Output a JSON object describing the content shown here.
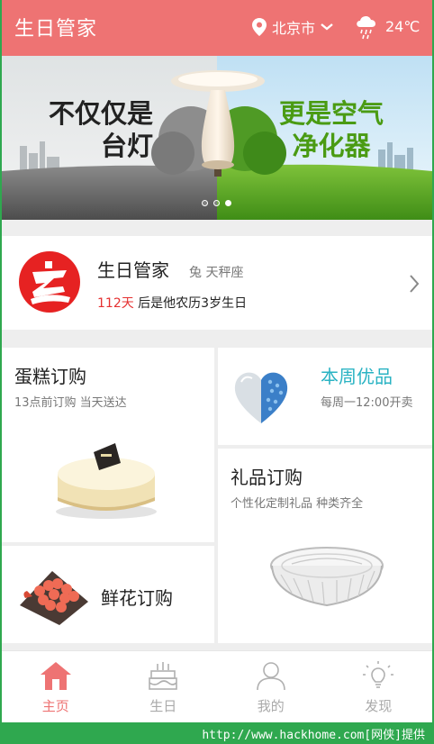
{
  "header": {
    "title": "生日管家",
    "city": "北京市",
    "temperature": "24℃",
    "icons": [
      "location-pin-icon",
      "chevron-down-icon",
      "rain-cloud-icon"
    ]
  },
  "banner": {
    "left_text_line1": "不仅仅是",
    "left_text_line2": "台灯",
    "right_text_line1": "更是空气",
    "right_text_line2": "净化器",
    "page_count": 3,
    "active_page": 3
  },
  "profile": {
    "name": "生日管家",
    "zodiac": "兔 天秤座",
    "days_number": "112天",
    "days_suffix": " 后是他农历3岁生日"
  },
  "cards": {
    "cake": {
      "title": "蛋糕订购",
      "subtitle": "13点前订购 当天送达"
    },
    "weekly": {
      "title": "本周优品",
      "subtitle": "每周一12:00开卖",
      "title_color": "#2ab3c3"
    },
    "gift": {
      "title": "礼品订购",
      "subtitle": "个性化定制礼品 种类齐全"
    },
    "flower": {
      "title": "鲜花订购"
    }
  },
  "nav": {
    "items": [
      {
        "label": "主页",
        "icon": "home-icon",
        "active": true
      },
      {
        "label": "生日",
        "icon": "birthday-cake-icon",
        "active": false
      },
      {
        "label": "我的",
        "icon": "user-icon",
        "active": false
      },
      {
        "label": "发现",
        "icon": "lightbulb-icon",
        "active": false
      }
    ]
  },
  "watermark": "http://www.hackhome.com[网侠]提供",
  "colors": {
    "brand": "#ee7373",
    "accent_red": "#e53030",
    "teal": "#2ab3c3"
  }
}
